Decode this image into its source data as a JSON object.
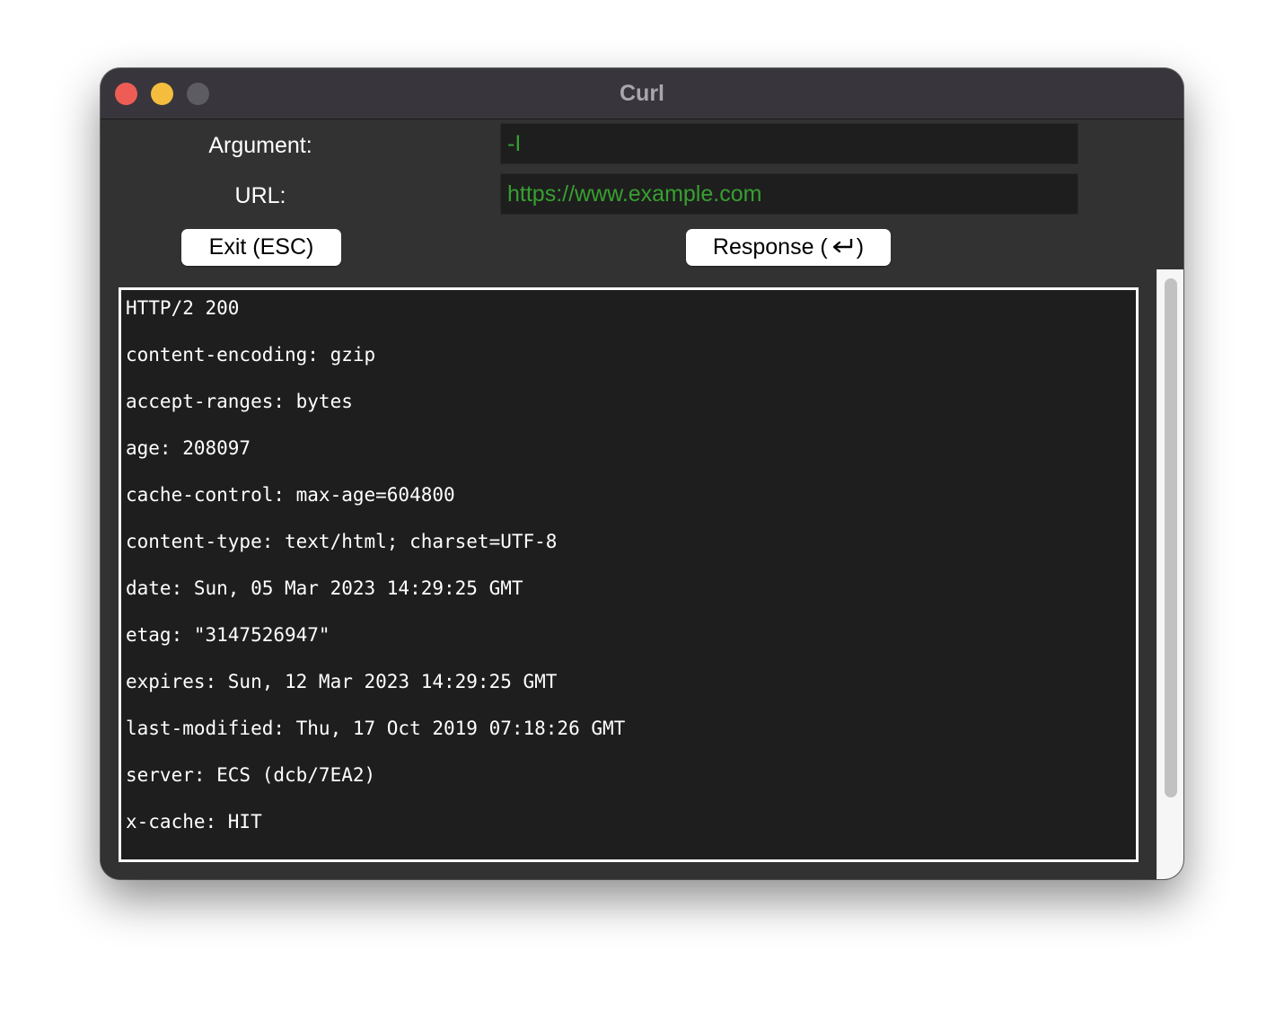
{
  "window": {
    "title": "Curl"
  },
  "form": {
    "argument_label": "Argument:",
    "argument_value": "-I",
    "url_label": "URL:",
    "url_value": "https://www.example.com"
  },
  "buttons": {
    "exit_label": "Exit (ESC)",
    "response_label_prefix": "Response (",
    "response_label_suffix": ")",
    "response_icon": "return-key-icon"
  },
  "output": {
    "lines": [
      "HTTP/2 200",
      "content-encoding: gzip",
      "accept-ranges: bytes",
      "age: 208097",
      "cache-control: max-age=604800",
      "content-type: text/html; charset=UTF-8",
      "date: Sun, 05 Mar 2023 14:29:25 GMT",
      "etag: \"3147526947\"",
      "expires: Sun, 12 Mar 2023 14:29:25 GMT",
      "last-modified: Thu, 17 Oct 2019 07:18:26 GMT",
      "server: ECS (dcb/7EA2)",
      "x-cache: HIT"
    ]
  },
  "colors": {
    "input_text": "#37a030",
    "window_bg": "#323232",
    "output_bg": "#1e1e1e",
    "close": "#ee5d55",
    "minimize": "#f4bd3e",
    "maximize_disabled": "#5d5c62"
  }
}
